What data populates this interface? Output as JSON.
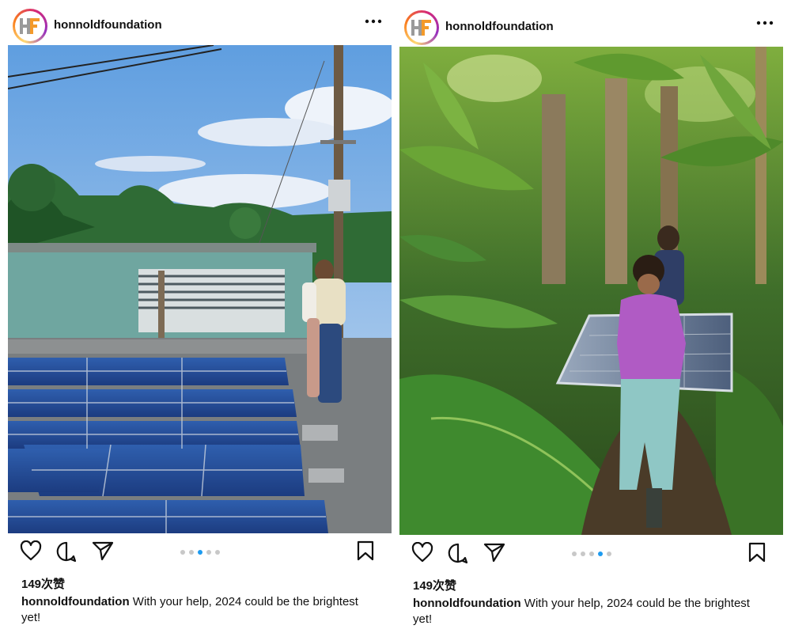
{
  "posts": [
    {
      "username": "honnoldfoundation",
      "avatar_text": "HF",
      "likes": "149次赞",
      "caption_user": "honnoldfoundation",
      "caption_text": "With your help, 2024 could be the brightest yet!",
      "carousel_total": 5,
      "carousel_active": 3,
      "photo": "rooftop-solar-panels",
      "icons": [
        "heart-icon",
        "comment-icon",
        "share-icon",
        "bookmark-icon",
        "more-icon"
      ]
    },
    {
      "username": "honnoldfoundation",
      "avatar_text": "HF",
      "likes": "149次赞",
      "caption_user": "honnoldfoundation",
      "caption_text": "With your help, 2024 could be the brightest yet!",
      "carousel_total": 5,
      "carousel_active": 4,
      "photo": "jungle-solar-panel-carry",
      "icons": [
        "heart-icon",
        "comment-icon",
        "share-icon",
        "bookmark-icon",
        "more-icon"
      ]
    }
  ],
  "colors": {
    "carousel_active": "#1d9bf0",
    "carousel_inactive": "#c8c8c8",
    "text": "#111111"
  }
}
